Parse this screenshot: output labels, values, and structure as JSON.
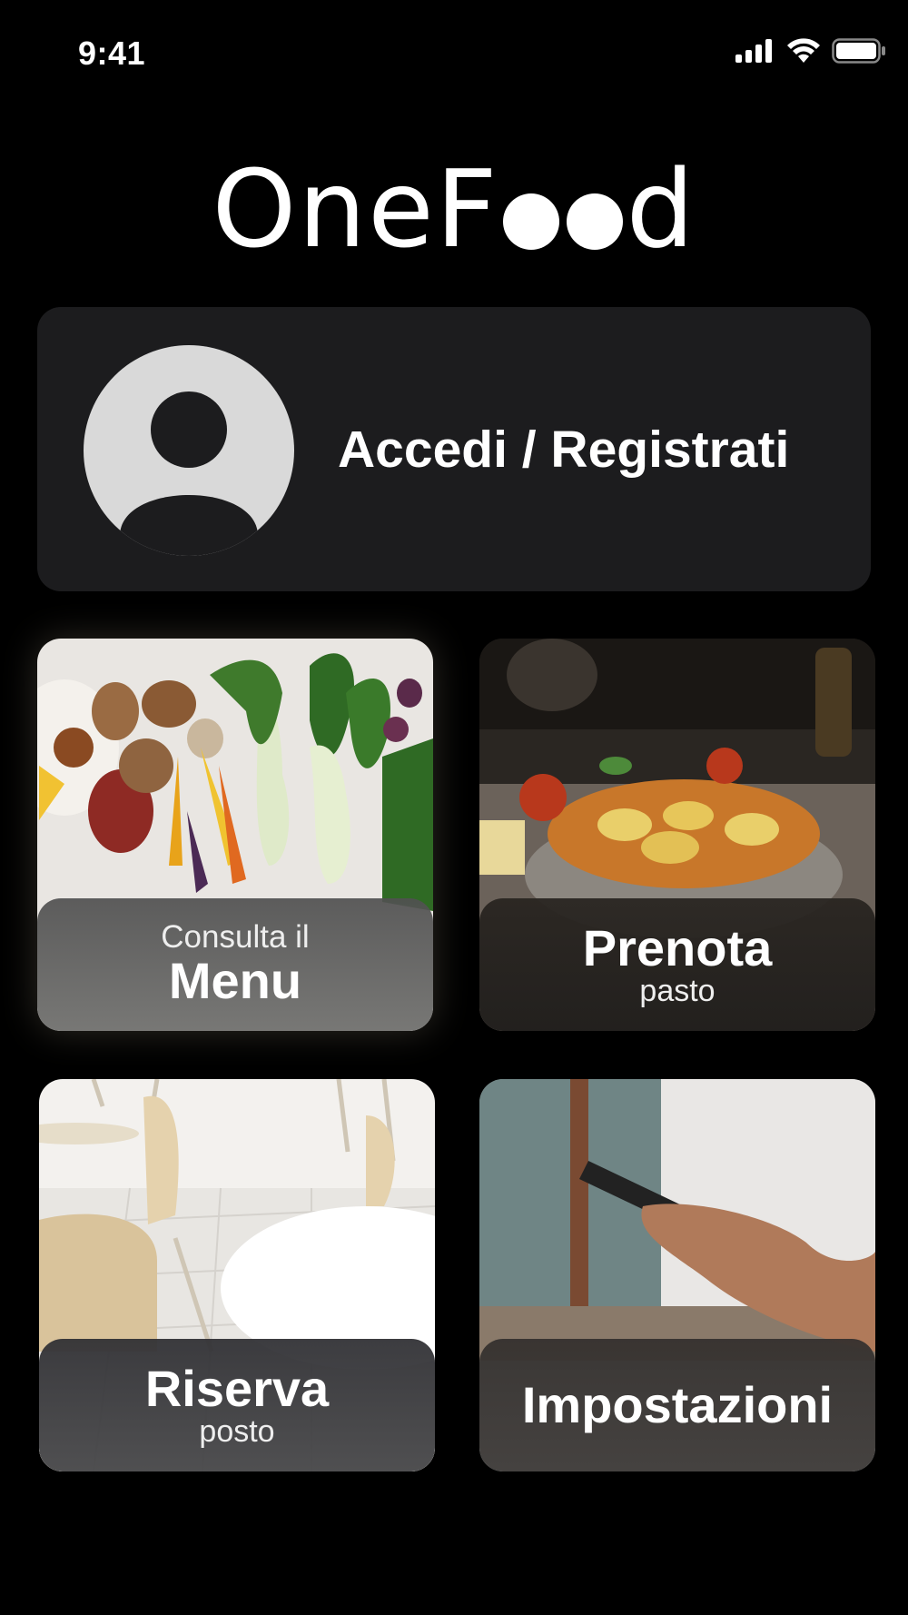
{
  "status_bar": {
    "time": "9:41",
    "icons": [
      "cellular-signal-icon",
      "wifi-icon",
      "battery-icon"
    ]
  },
  "app": {
    "logo": {
      "prefix": "OneF",
      "suffix": "d"
    }
  },
  "account": {
    "label": "Accedi / Registrati",
    "icon": "user-avatar-icon"
  },
  "tiles": [
    {
      "id": "menu",
      "sub_top": "Consulta il",
      "main": "Menu",
      "sub_bottom": "",
      "image": "vegetables-photo"
    },
    {
      "id": "prenota",
      "sub_top": "",
      "main": "Prenota",
      "sub_bottom": "pasto",
      "image": "pasta-bowl-photo"
    },
    {
      "id": "riserva",
      "sub_top": "",
      "main": "Riserva",
      "sub_bottom": "posto",
      "image": "cafeteria-chairs-photo"
    },
    {
      "id": "impostazioni",
      "sub_top": "",
      "main": "Impostazioni",
      "sub_bottom": "",
      "image": "hand-holding-phone-photo"
    }
  ],
  "colors": {
    "background": "#000000",
    "card": "#1c1c1e",
    "avatar": "#d9d9d9",
    "text": "#ffffff"
  }
}
